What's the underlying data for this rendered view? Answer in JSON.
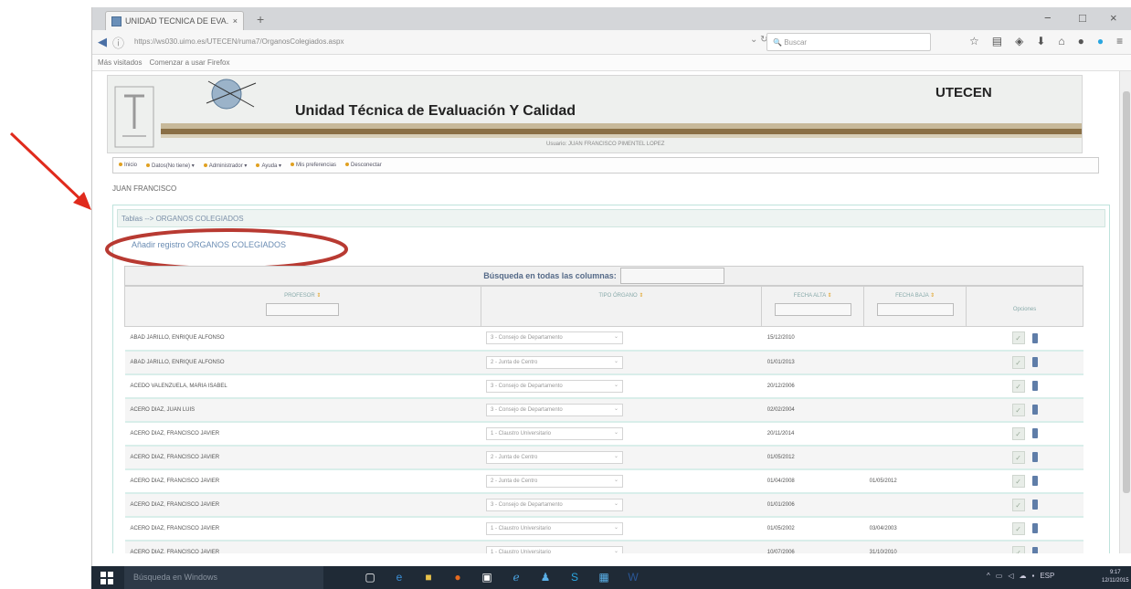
{
  "browser": {
    "tab_title": "UNIDAD TECNICA DE EVA...",
    "tab_close": "×",
    "new_tab": "+",
    "url": "https://ws030.uimo.es/UTECEN/ruma7/OrganosColegiados.aspx",
    "search_placeholder": "Buscar",
    "bookmarks": [
      "Más visitados",
      "Comenzar a usar Firefox"
    ],
    "win_min": "−",
    "win_max": "□",
    "win_close": "×"
  },
  "site": {
    "title": "Unidad Técnica de Evaluación Y Calidad",
    "brand": "UTECEN",
    "user_line": "Usuario: JUAN FRANCISCO PIMENTEL LOPEZ"
  },
  "menu": [
    "Inicio",
    "Datos(No tiene)",
    "Administrador",
    "Ayuda",
    "Mis preferencias",
    "Desconectar"
  ],
  "current_user": "JUAN FRANCISCO",
  "panel": {
    "header": "Tablas --> ORGANOS COLEGIADOS",
    "add_link": "Añadir registro ORGANOS COLEGIADOS",
    "global_search_label": "Búsqueda en todas las columnas:"
  },
  "table": {
    "columns": [
      "PROFESOR",
      "TIPO ÓRGANO",
      "FECHA ALTA",
      "FECHA BAJA",
      "Opciones"
    ],
    "rows": [
      {
        "profesor": "ABAD JARILLO, ENRIQUE ALFONSO",
        "tipo": "3 - Consejo de Departamento",
        "alta": "15/12/2010",
        "baja": ""
      },
      {
        "profesor": "ABAD JARILLO, ENRIQUE ALFONSO",
        "tipo": "2 - Junta de Centro",
        "alta": "01/01/2013",
        "baja": ""
      },
      {
        "profesor": "ACEDO VALENZUELA, MARIA ISABEL",
        "tipo": "3 - Consejo de Departamento",
        "alta": "20/12/2006",
        "baja": ""
      },
      {
        "profesor": "ACERO DIAZ, JUAN LUIS",
        "tipo": "3 - Consejo de Departamento",
        "alta": "02/02/2004",
        "baja": ""
      },
      {
        "profesor": "ACERO DIAZ, FRANCISCO JAVIER",
        "tipo": "1 - Claustro Universitario",
        "alta": "20/11/2014",
        "baja": ""
      },
      {
        "profesor": "ACERO DIAZ, FRANCISCO JAVIER",
        "tipo": "2 - Junta de Centro",
        "alta": "01/05/2012",
        "baja": ""
      },
      {
        "profesor": "ACERO DIAZ, FRANCISCO JAVIER",
        "tipo": "2 - Junta de Centro",
        "alta": "01/04/2008",
        "baja": "01/05/2012"
      },
      {
        "profesor": "ACERO DIAZ, FRANCISCO JAVIER",
        "tipo": "3 - Consejo de Departamento",
        "alta": "01/01/2006",
        "baja": ""
      },
      {
        "profesor": "ACERO DIAZ, FRANCISCO JAVIER",
        "tipo": "1 - Claustro Universitario",
        "alta": "01/05/2002",
        "baja": "03/04/2003"
      },
      {
        "profesor": "ACERO DIAZ, FRANCISCO JAVIER",
        "tipo": "1 - Claustro Universitario",
        "alta": "10/07/2006",
        "baja": "31/10/2010"
      }
    ]
  },
  "taskbar": {
    "search": "Búsqueda en Windows",
    "lang": "ESP",
    "time": "9:17",
    "date": "12/11/2015"
  },
  "colors": {
    "annotation": "#c0392b",
    "accent": "#5f7da8"
  },
  "icons": [
    "windows-start-icon",
    "ie-icon",
    "edge-icon",
    "folder-icon",
    "firefox-icon",
    "store-icon",
    "word-icon"
  ]
}
